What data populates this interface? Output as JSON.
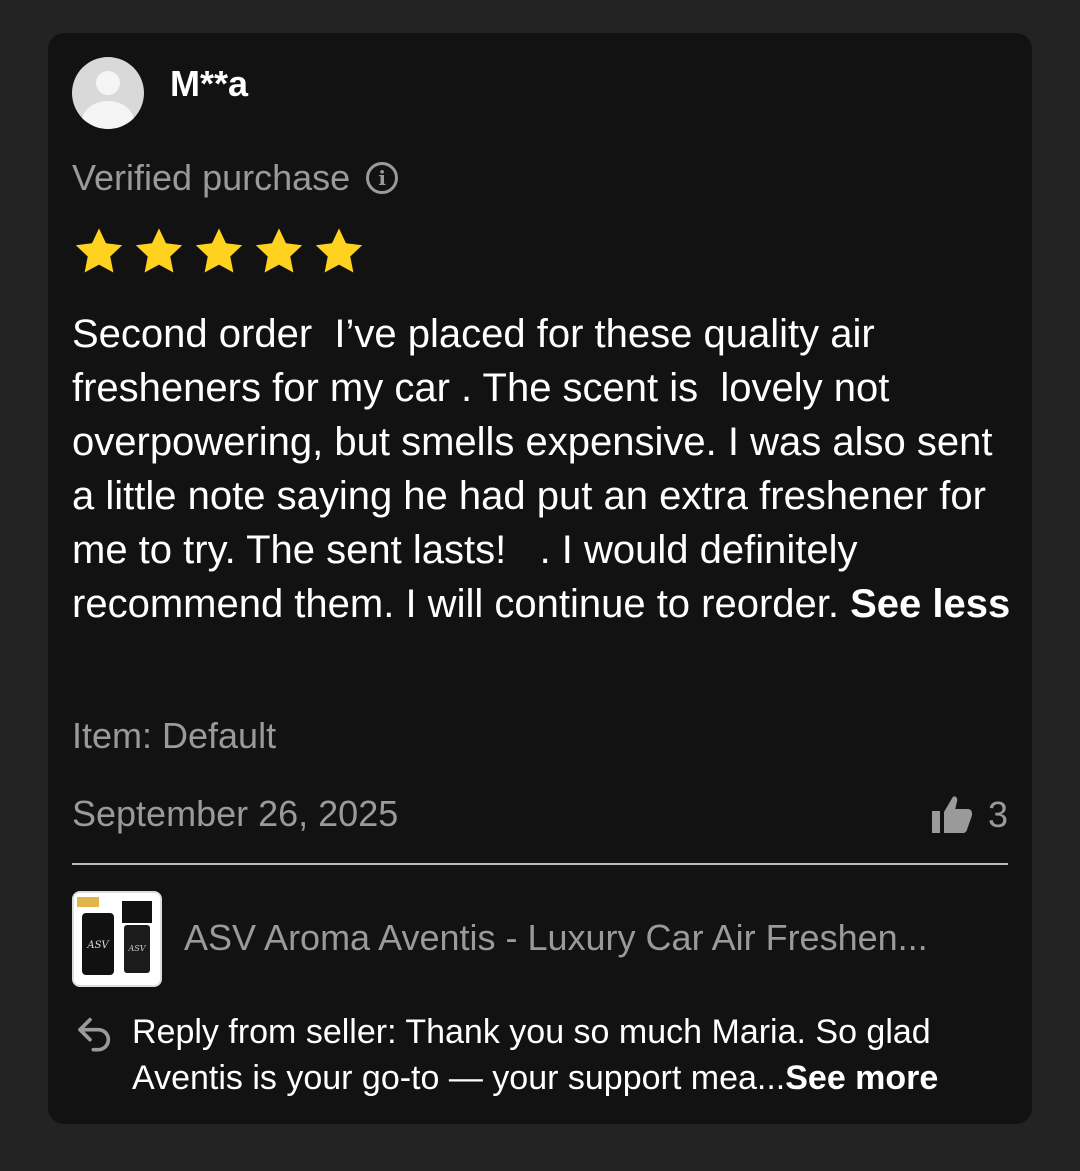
{
  "review": {
    "username": "M**a",
    "verified_label": "Verified purchase",
    "rating": 5,
    "rating_max": 5,
    "text": "Second order  I’ve placed for these quality air fresheners for my car . The scent is  lovely not overpowering, but smells expensive. I was also sent a little note saying he had put an extra freshener for me to try. The sent lasts!   . I would definitely recommend them. I will continue to reorder. ",
    "see_less_label": "See less",
    "item_label": "Item: Default",
    "date": "September 26, 2025",
    "helpful_count": "3"
  },
  "product": {
    "title": "ASV Aroma Aventis - Luxury Car Air Freshen..."
  },
  "seller_reply": {
    "text": "Reply from seller: Thank you so much Maria. So glad Aventis is your go-to — your support mea...",
    "see_more_label": "See more"
  },
  "colors": {
    "background": "#232323",
    "card": "#121212",
    "star": "#FFD21F",
    "muted_text": "#9a9a9a"
  },
  "icons": [
    "user-avatar-icon",
    "info-icon",
    "star-icon",
    "thumbs-up-icon",
    "reply-icon"
  ]
}
